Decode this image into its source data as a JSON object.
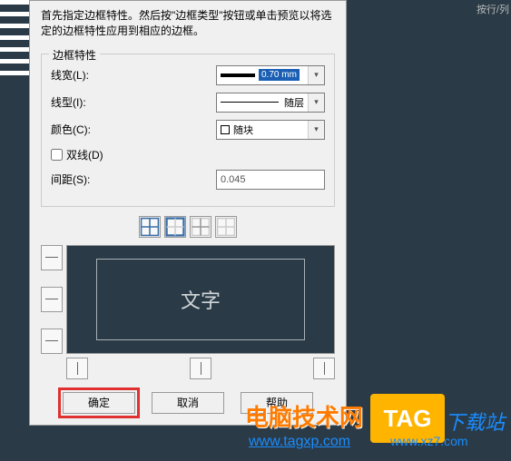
{
  "instruction": "首先指定边框特性。然后按\"边框类型\"按钮或单击预览以将选定的边框特性应用到相应的边框。",
  "fieldset_title": "边框特性",
  "labels": {
    "linewidth": "线宽(L):",
    "linetype": "线型(I):",
    "color": "颜色(C):",
    "doubleline": "双线(D)",
    "spacing": "间距(S):"
  },
  "values": {
    "linewidth": "0.70 mm",
    "linetype": "随层",
    "color": "随块",
    "spacing": "0.045"
  },
  "preview_text": "文字",
  "buttons": {
    "ok": "确定",
    "cancel": "取消",
    "help": "帮助"
  },
  "watermark": {
    "text": "电脑技术网",
    "url": "www.tagxp.com",
    "tag": "TAG",
    "dlz": "下载站",
    "dlz_url": "www.xz7.com"
  },
  "top_right": "按行/列"
}
